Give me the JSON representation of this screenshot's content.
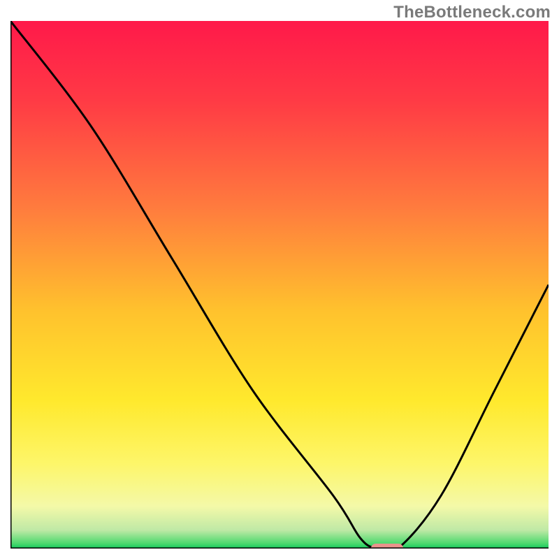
{
  "watermark": "TheBottleneck.com",
  "chart_data": {
    "type": "line",
    "title": "",
    "xlabel": "",
    "ylabel": "",
    "xlim": [
      0,
      100
    ],
    "ylim": [
      0,
      100
    ],
    "grid": false,
    "legend": false,
    "series": [
      {
        "name": "bottleneck-curve",
        "x": [
          0,
          15,
          30,
          45,
          60,
          65,
          68,
          72,
          80,
          90,
          100
        ],
        "values": [
          100,
          80,
          55,
          30,
          10,
          2,
          0,
          0,
          10,
          30,
          50
        ]
      }
    ],
    "marker": {
      "x": 70,
      "y": 0,
      "width": 6,
      "color": "#e9938c",
      "shape": "rounded-rect"
    },
    "gradient_stops": [
      {
        "offset": 0.0,
        "color": "#ff194a"
      },
      {
        "offset": 0.15,
        "color": "#ff3a45"
      },
      {
        "offset": 0.35,
        "color": "#ff7a3e"
      },
      {
        "offset": 0.55,
        "color": "#ffc22d"
      },
      {
        "offset": 0.72,
        "color": "#ffe92d"
      },
      {
        "offset": 0.84,
        "color": "#fdf66a"
      },
      {
        "offset": 0.92,
        "color": "#f4f9a8"
      },
      {
        "offset": 0.965,
        "color": "#bfe9a6"
      },
      {
        "offset": 0.99,
        "color": "#4fd96f"
      },
      {
        "offset": 1.0,
        "color": "#12c95c"
      }
    ]
  }
}
